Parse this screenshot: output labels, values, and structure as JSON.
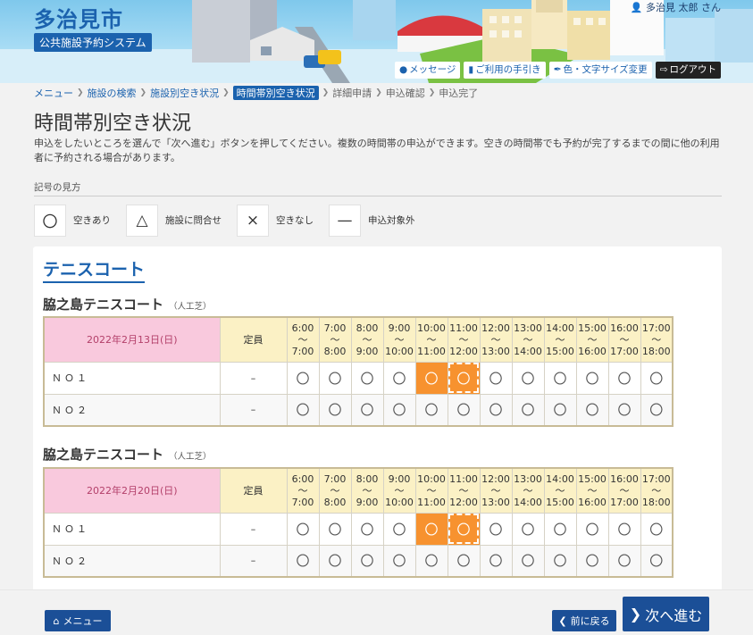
{
  "header": {
    "site_title": "多治見市",
    "site_subtitle": "公共施設予約システム",
    "user_name": "多治見 太郎 さん",
    "nav": [
      {
        "label": "メッセージ",
        "icon": "chat-icon"
      },
      {
        "label": "ご利用の手引き",
        "icon": "book-icon"
      },
      {
        "label": "色・文字サイズ変更",
        "icon": "brush-icon"
      },
      {
        "label": "ログアウト",
        "icon": "logout-icon"
      }
    ]
  },
  "breadcrumb": [
    {
      "label": "メニュー",
      "state": "link"
    },
    {
      "label": "施設の検索",
      "state": "link"
    },
    {
      "label": "施設別空き状況",
      "state": "link"
    },
    {
      "label": "時間帯別空き状況",
      "state": "current"
    },
    {
      "label": "詳細申請",
      "state": "future"
    },
    {
      "label": "申込確認",
      "state": "future"
    },
    {
      "label": "申込完了",
      "state": "future"
    }
  ],
  "page": {
    "title": "時間帯別空き状況",
    "description": "申込をしたいところを選んで「次へ進む」ボタンを押してください。複数の時間帯の申込ができます。空きの時間帯でも予約が完了するまでの間に他の利用者に予約される場合があります。"
  },
  "legend": {
    "title": "記号の見方",
    "items": [
      {
        "symbol": "〇",
        "label": "空きあり"
      },
      {
        "symbol": "△",
        "label": "施設に問合せ"
      },
      {
        "symbol": "×",
        "label": "空きなし"
      },
      {
        "symbol": "—",
        "label": "申込対象外"
      }
    ]
  },
  "facility": {
    "name": "テニスコート",
    "capacity_header": "定員",
    "slots": [
      {
        "from": "6:00",
        "sep": "～",
        "to": "7:00"
      },
      {
        "from": "7:00",
        "sep": "～",
        "to": "8:00"
      },
      {
        "from": "8:00",
        "sep": "～",
        "to": "9:00"
      },
      {
        "from": "9:00",
        "sep": "～",
        "to": "10:00"
      },
      {
        "from": "10:00",
        "sep": "～",
        "to": "11:00"
      },
      {
        "from": "11:00",
        "sep": "～",
        "to": "12:00"
      },
      {
        "from": "12:00",
        "sep": "～",
        "to": "13:00"
      },
      {
        "from": "13:00",
        "sep": "～",
        "to": "14:00"
      },
      {
        "from": "14:00",
        "sep": "～",
        "to": "15:00"
      },
      {
        "from": "15:00",
        "sep": "～",
        "to": "16:00"
      },
      {
        "from": "16:00",
        "sep": "～",
        "to": "17:00"
      },
      {
        "from": "17:00",
        "sep": "～",
        "to": "18:00"
      }
    ],
    "blocks": [
      {
        "room": "脇之島テニスコート",
        "note": "（人工芝）",
        "date": "2022年2月13日(日)",
        "rows": [
          {
            "name": "ＮＯ１",
            "capacity": "–",
            "marks": [
              "〇",
              "〇",
              "〇",
              "〇",
              "〇",
              "〇",
              "〇",
              "〇",
              "〇",
              "〇",
              "〇",
              "〇"
            ],
            "selected": [
              4,
              5
            ]
          },
          {
            "name": "ＮＯ２",
            "capacity": "–",
            "marks": [
              "〇",
              "〇",
              "〇",
              "〇",
              "〇",
              "〇",
              "〇",
              "〇",
              "〇",
              "〇",
              "〇",
              "〇"
            ],
            "selected": []
          }
        ]
      },
      {
        "room": "脇之島テニスコート",
        "note": "（人工芝）",
        "date": "2022年2月20日(日)",
        "rows": [
          {
            "name": "ＮＯ１",
            "capacity": "–",
            "marks": [
              "〇",
              "〇",
              "〇",
              "〇",
              "〇",
              "〇",
              "〇",
              "〇",
              "〇",
              "〇",
              "〇",
              "〇"
            ],
            "selected": [
              4,
              5
            ]
          },
          {
            "name": "ＮＯ２",
            "capacity": "–",
            "marks": [
              "〇",
              "〇",
              "〇",
              "〇",
              "〇",
              "〇",
              "〇",
              "〇",
              "〇",
              "〇",
              "〇",
              "〇"
            ],
            "selected": []
          }
        ]
      }
    ]
  },
  "footer": {
    "menu_label": "メニュー",
    "back_label": "前に戻る",
    "next_label": "次へ進む"
  },
  "colors": {
    "brand": "#1b62ae",
    "selected": "#f7922f",
    "date_header": "#f9c9dd",
    "slot_header": "#fbf1c5"
  }
}
